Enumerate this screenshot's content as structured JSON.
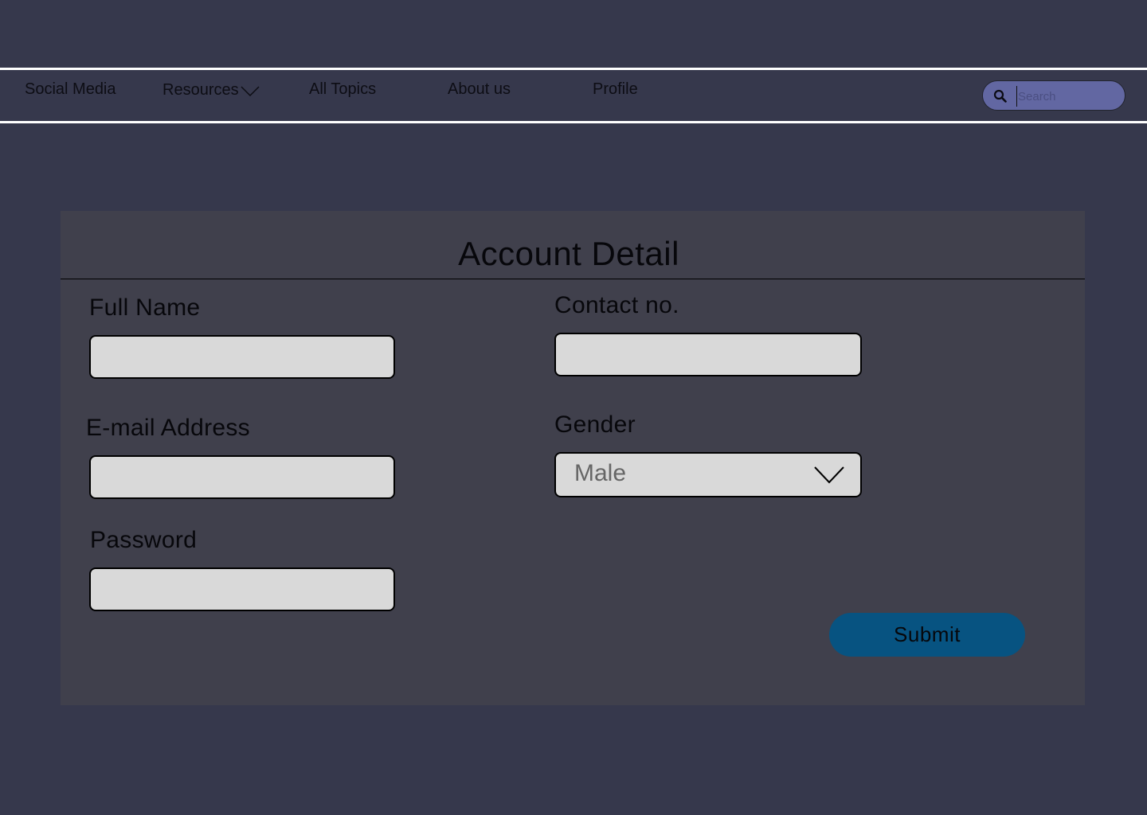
{
  "nav": {
    "items": [
      {
        "label": "Social Media"
      },
      {
        "label": "Resources",
        "has_dropdown": true
      },
      {
        "label": "All Topics"
      },
      {
        "label": "About us"
      },
      {
        "label": "Profile"
      }
    ],
    "search_placeholder": "Search",
    "search_icon": "search-icon",
    "dropdown_icon": "chevron-down-icon"
  },
  "form": {
    "title": "Account Detail",
    "fields": {
      "full_name": {
        "label": "Full Name",
        "value": ""
      },
      "email": {
        "label": "E-mail Address",
        "value": ""
      },
      "password": {
        "label": "Password",
        "value": ""
      },
      "contact": {
        "label": "Contact no.",
        "value": ""
      },
      "gender": {
        "label": "Gender",
        "value": "Male",
        "icon": "chevron-down-icon"
      }
    },
    "submit_label": "Submit"
  },
  "colors": {
    "background": "#36384c",
    "card": "#40404c",
    "input_fill": "#d9d9d9",
    "search_fill": "#6267a2",
    "submit": "#075381",
    "divider_lines": "#ffffff"
  }
}
